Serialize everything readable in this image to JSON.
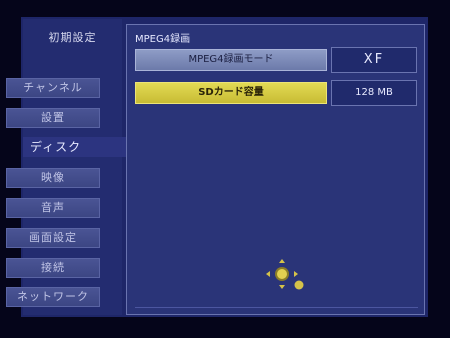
{
  "sidebar": {
    "title": "初期設定",
    "items": [
      {
        "label": "チャンネル"
      },
      {
        "label": "設置"
      },
      {
        "label": "ディスク"
      },
      {
        "label": "映像"
      },
      {
        "label": "音声"
      },
      {
        "label": "画面設定"
      },
      {
        "label": "接続"
      },
      {
        "label": "ネットワーク"
      }
    ],
    "active_index": 2
  },
  "panel": {
    "title": "MPEG4録画",
    "rows": [
      {
        "label": "MPEG4録画モード",
        "value": "XF"
      },
      {
        "label": "SDカード容量",
        "value": "128 MB"
      }
    ]
  },
  "icons": {
    "nav": "remote-dpad-icon",
    "accent": "#d4c24a"
  }
}
